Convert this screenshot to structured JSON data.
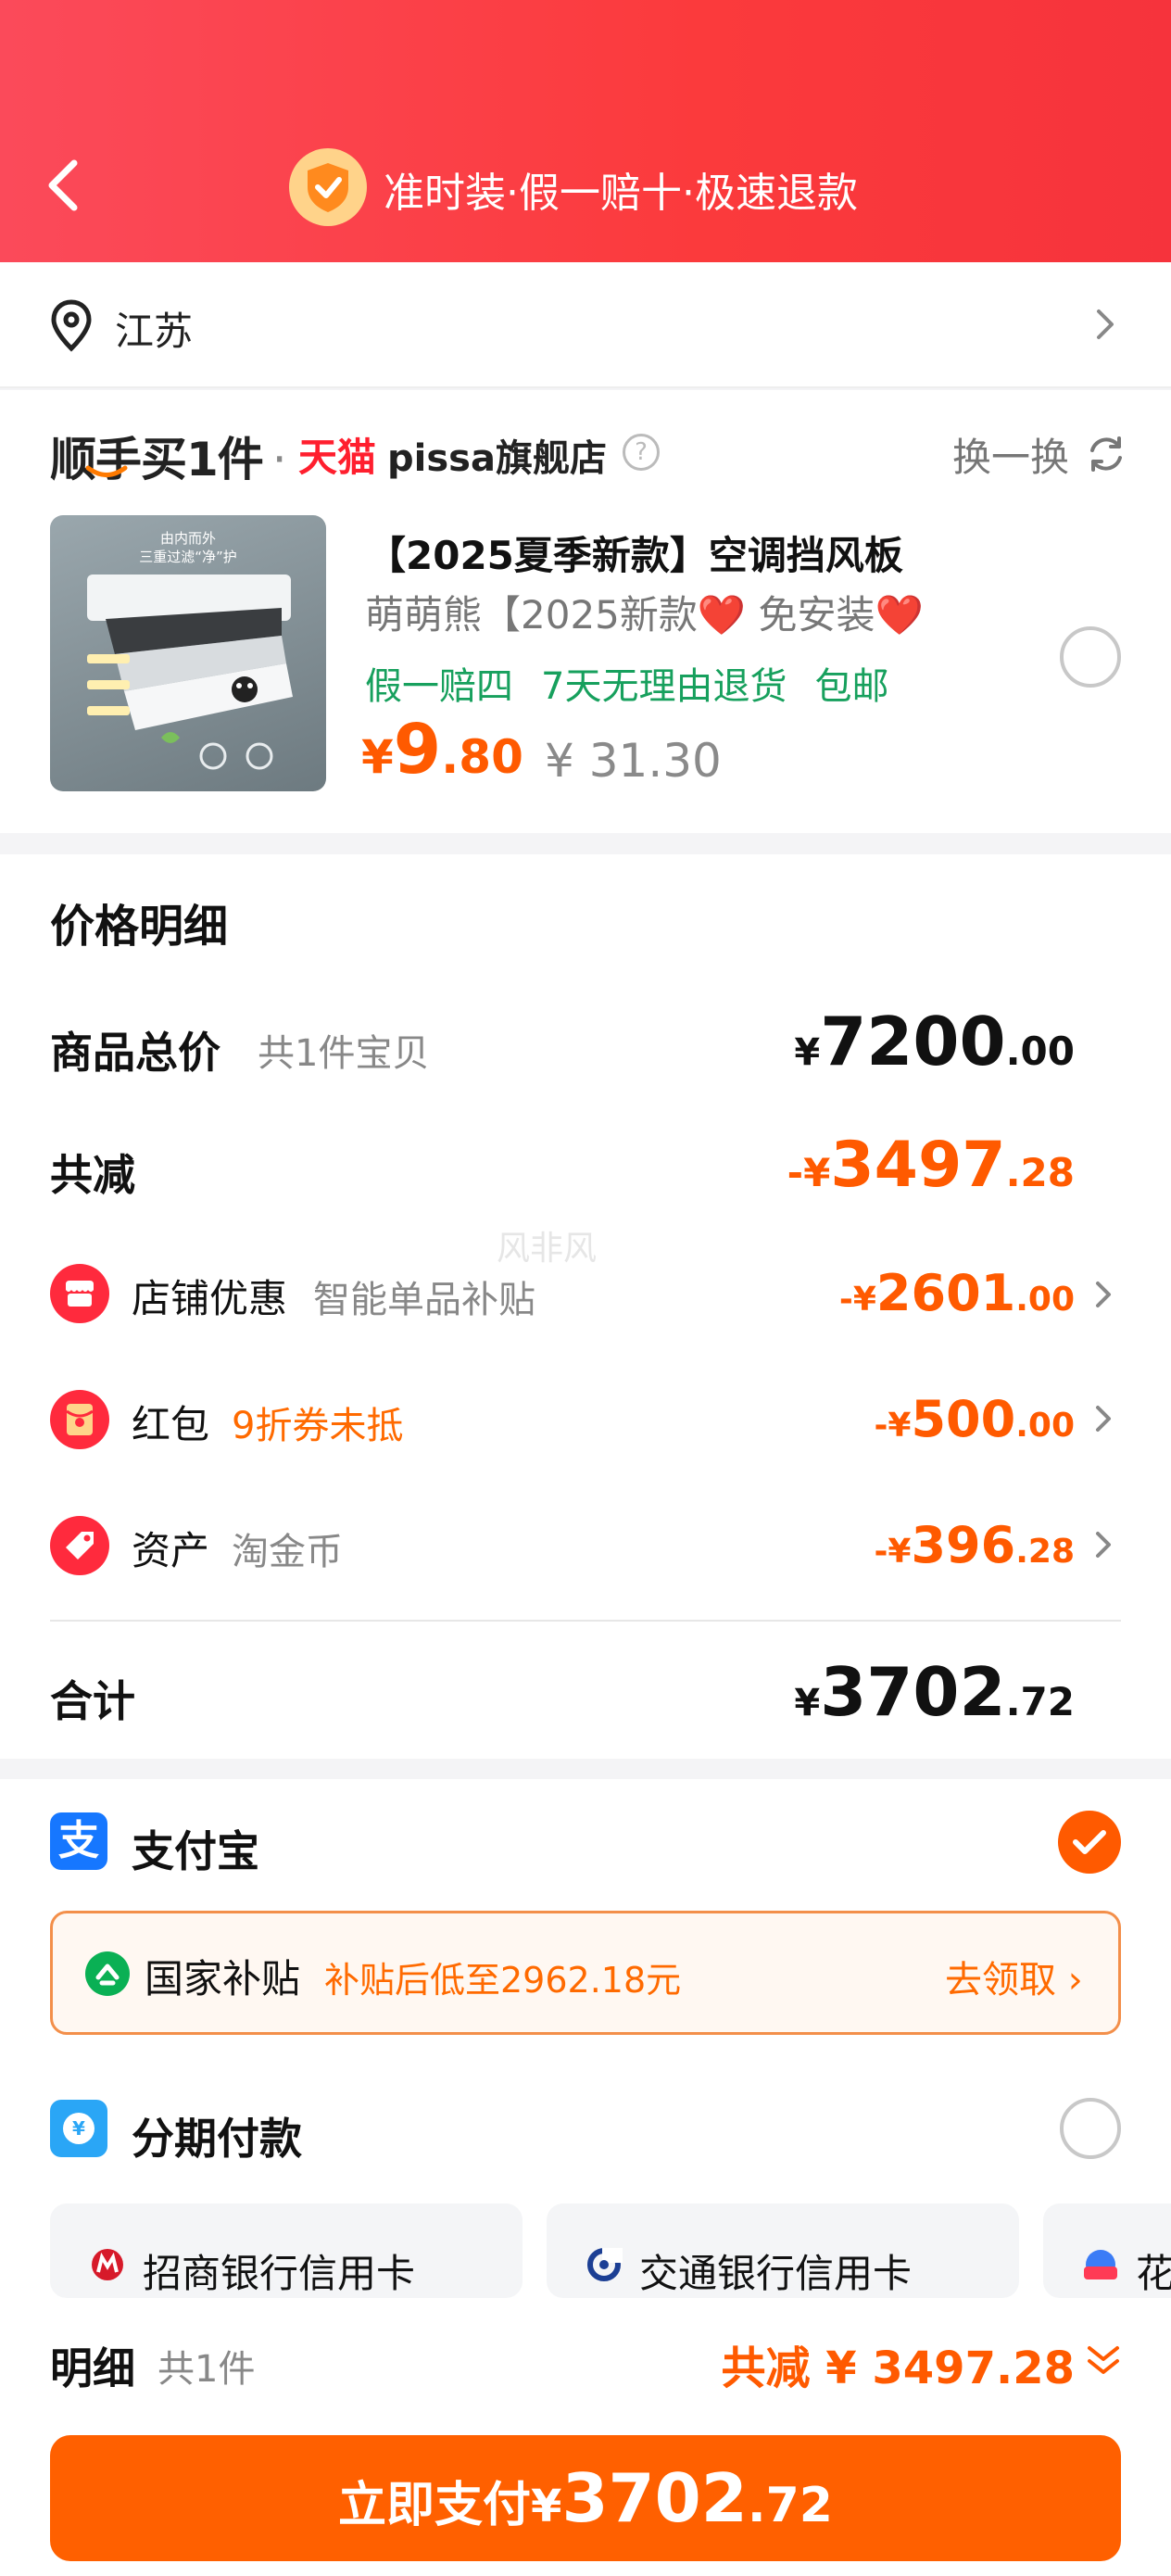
{
  "header": {
    "back_label": "",
    "banner_text": "准时装·假一赔十·极速退款",
    "colors": {
      "gradient_start": "#fb4a5a",
      "gradient_end": "#f6333c",
      "shield": "#ffd38a"
    }
  },
  "location": {
    "text": "江苏",
    "icon": "location-pin-icon"
  },
  "product": {
    "promo_label": "顺手买1件",
    "platform": "天猫",
    "shop_name": "pissa旗舰店",
    "help_symbol": "?",
    "swap_label": "换一换",
    "title": "【2025夏季新款】空调挡风板",
    "subtitle": "萌萌熊【2025新款❤️ 免安装❤️",
    "tags": [
      "假一赔四",
      "7天无理由退货",
      "包邮"
    ],
    "price_currency": "¥",
    "price_int": "9",
    "price_dec": ".80",
    "original_price": "¥ 31.30",
    "thumb_caption_1": "由内而外",
    "thumb_caption_2": "三重过滤“净”护",
    "selected": false
  },
  "price_detail": {
    "title": "价格明细",
    "total_label": "商品总价",
    "total_sub": "共1件宝贝",
    "total_currency": "¥",
    "total_int": "7200",
    "total_dec": ".00",
    "reduce_label": "共减",
    "reduce_prefix": "-¥",
    "reduce_int": "3497",
    "reduce_dec": ".28",
    "items": [
      {
        "label": "店铺优惠",
        "sub": "智能单品补贴",
        "prefix": "-¥",
        "int": "2601",
        "dec": ".00",
        "icon": "shop-icon"
      },
      {
        "label": "红包",
        "sub": "9折券未抵",
        "prefix": "-¥",
        "int": "500",
        "dec": ".00",
        "icon": "red-envelope-icon"
      },
      {
        "label": "资产",
        "sub": "淘金币",
        "prefix": "-¥",
        "int": "396",
        "dec": ".28",
        "icon": "tag-icon"
      }
    ],
    "sum_label": "合计",
    "sum_currency": "¥",
    "sum_int": "3702",
    "sum_dec": ".72",
    "watermark": "风非风"
  },
  "payment": {
    "alipay_label": "支付宝",
    "alipay_icon_text": "支",
    "alipay_selected": true,
    "subsidy_label": "国家补贴",
    "subsidy_sub": "补贴后低至2962.18元",
    "subsidy_link": "去领取 ›",
    "installment_label": "分期付款",
    "installment_selected": false,
    "banks": [
      "招商银行信用卡",
      "交通银行信用卡",
      "花"
    ],
    "colors": {
      "accent": "#ff5a00",
      "alipay": "#1677ff",
      "subsidy_border": "#f38f4a"
    }
  },
  "bottom": {
    "detail_label": "明细",
    "detail_count": "共1件",
    "reduce_text": "共减 ¥ 3497.28",
    "pay_label": "立即支付",
    "pay_currency": "¥",
    "pay_int": "3702",
    "pay_dec": ".72"
  }
}
